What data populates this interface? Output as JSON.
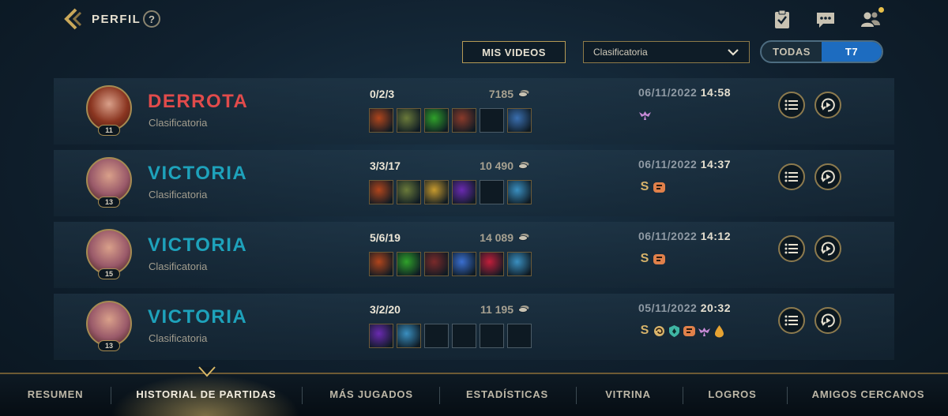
{
  "header": {
    "title": "PERFIL",
    "help": "?"
  },
  "icons": {
    "back": "back-chevron-icon",
    "help": "help-icon",
    "clipboard": "clipboard-check-icon",
    "chat": "chat-icon",
    "friends": "friends-icon"
  },
  "controls": {
    "videos_label": "MIS VIDEOS",
    "queue_select": "Clasificatoria",
    "filter_options": [
      "TODAS",
      "T7"
    ],
    "filter_active": "T7"
  },
  "matches": [
    {
      "result": "DERROTA",
      "outcome": "loss",
      "queue": "Clasificatoria",
      "level": "11",
      "kda": "0/2/3",
      "gold": "7185",
      "date": "06/11/2022",
      "time": "14:58"
    },
    {
      "result": "VICTORIA",
      "outcome": "win",
      "queue": "Clasificatoria",
      "level": "13",
      "kda": "3/3/17",
      "gold": "10 490",
      "date": "06/11/2022",
      "time": "14:37",
      "s_badge": "S"
    },
    {
      "result": "VICTORIA",
      "outcome": "win",
      "queue": "Clasificatoria",
      "level": "15",
      "kda": "5/6/19",
      "gold": "14 089",
      "date": "06/11/2022",
      "time": "14:12",
      "s_badge": "S"
    },
    {
      "result": "VICTORIA",
      "outcome": "win",
      "queue": "Clasificatoria",
      "level": "13",
      "kda": "3/2/20",
      "gold": "11 195",
      "date": "05/11/2022",
      "time": "20:32",
      "s_badge": "S"
    }
  ],
  "nav": {
    "tabs": [
      "RESUMEN",
      "HISTORIAL DE PARTIDAS",
      "MÁS JUGADOS",
      "ESTADÍSTICAS",
      "VITRINA",
      "LOGROS",
      "AMIGOS CERCANOS"
    ],
    "active": "HISTORIAL DE PARTIDAS"
  },
  "colors": {
    "win": "#1ea2bb",
    "loss": "#e14b4b",
    "gold_accent": "#b59a55",
    "active_filter": "#1d6cc0"
  }
}
